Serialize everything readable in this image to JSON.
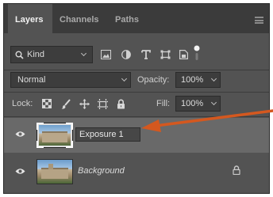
{
  "tabs": [
    {
      "label": "Layers",
      "active": true
    },
    {
      "label": "Channels",
      "active": false
    },
    {
      "label": "Paths",
      "active": false
    }
  ],
  "filter": {
    "kind_label": "Kind",
    "icons": [
      "pixel-filter-icon",
      "adjustment-filter-icon",
      "type-filter-icon",
      "shape-filter-icon",
      "smart-object-filter-icon",
      "filter-toggle-icon"
    ]
  },
  "blend": {
    "mode": "Normal",
    "opacity_label": "Opacity:",
    "opacity_value": "100%"
  },
  "lock": {
    "label": "Lock:",
    "icons": [
      "lock-transparent-pixels-icon",
      "lock-image-pixels-icon",
      "lock-position-icon",
      "lock-artboard-icon",
      "lock-all-icon"
    ],
    "fill_label": "Fill:",
    "fill_value": "100%"
  },
  "layers": [
    {
      "name": "Exposure 1",
      "selected": true,
      "editing": true,
      "locked": false,
      "visible": true
    },
    {
      "name": "Background",
      "selected": false,
      "editing": false,
      "locked": true,
      "visible": true
    }
  ],
  "colors": {
    "panel": "#535353",
    "tabbar": "#3b3b3b",
    "selected_row": "#696969",
    "arrow": "#d4581f"
  }
}
